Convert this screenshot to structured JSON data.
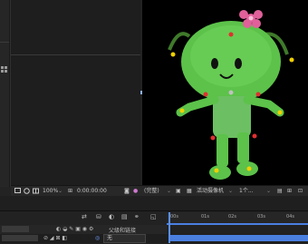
{
  "viewer_toolbar": {
    "zoom": "100%",
    "timecode": "0:00:00:00",
    "resolution": "(完整)",
    "camera": "活动摄像机",
    "views": "1个..."
  },
  "timeline": {
    "ruler_ticks": [
      "00s",
      "01s",
      "02s",
      "03s",
      "04s"
    ],
    "parent_link_label": "父级和链接",
    "parent_value": "无"
  },
  "colors": {
    "accent": "#4a7fe0",
    "character_green": "#5cc24a",
    "flower_pink": "#e0609a"
  }
}
